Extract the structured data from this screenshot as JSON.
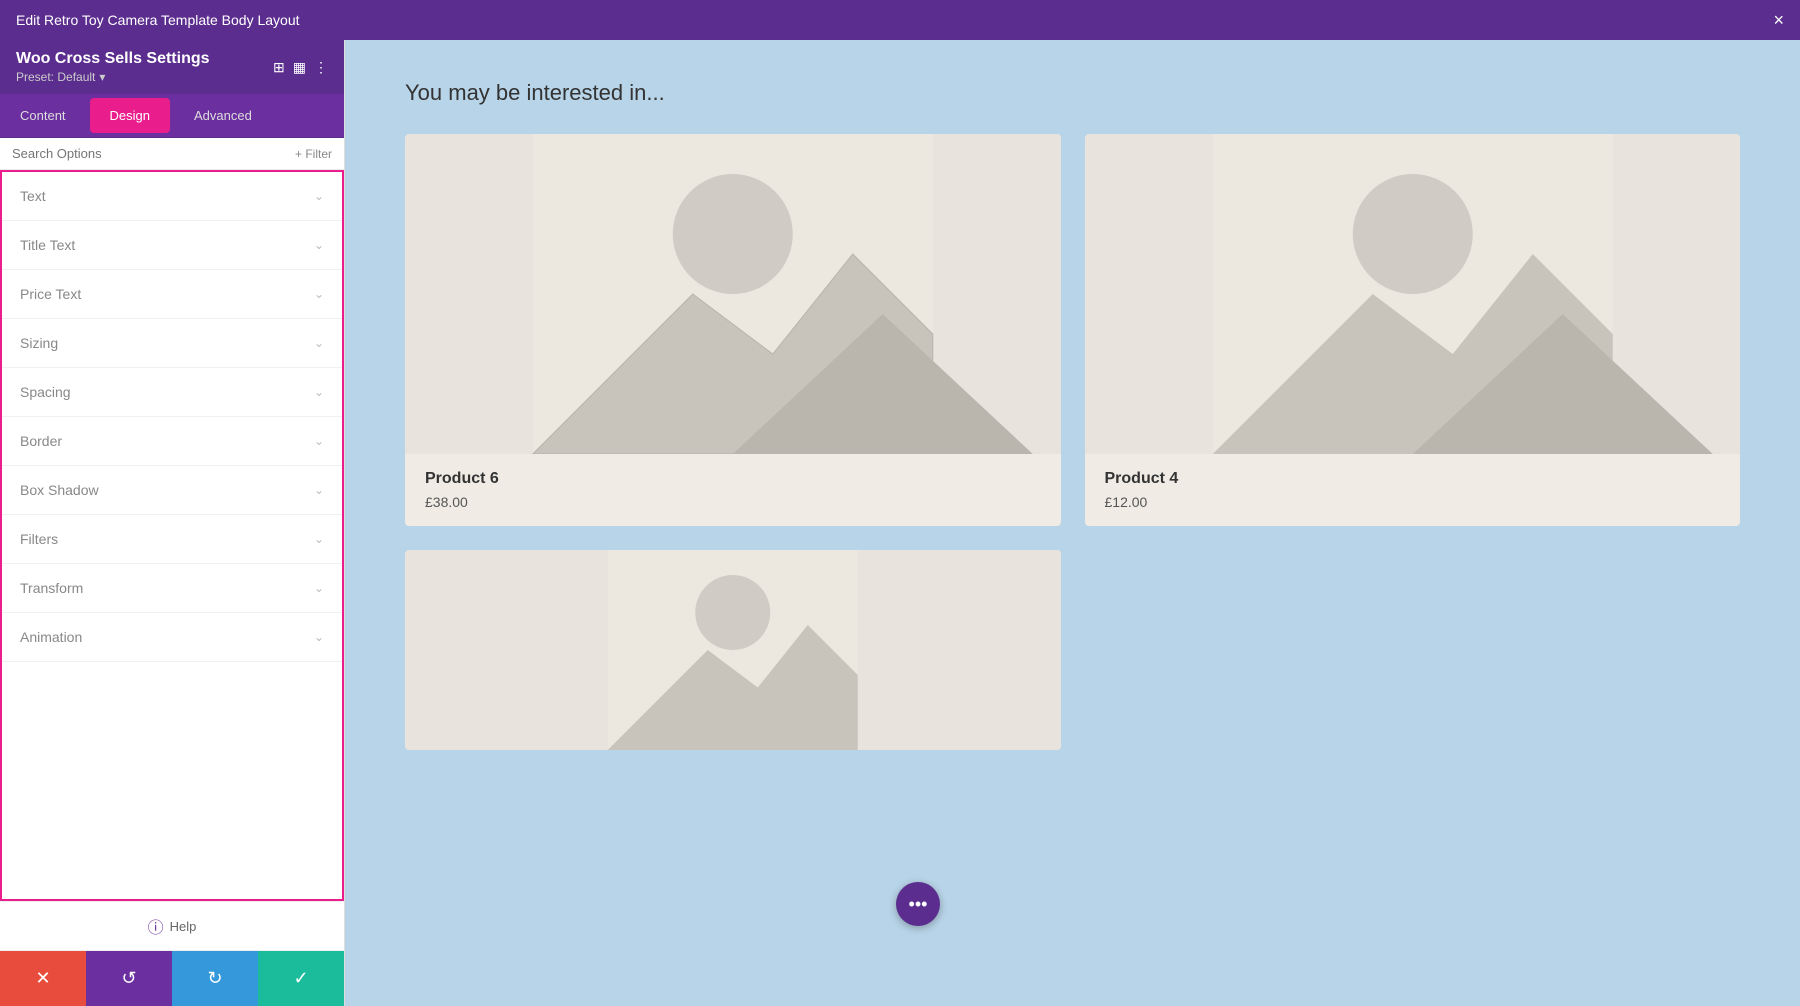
{
  "topBar": {
    "title": "Edit Retro Toy Camera Template Body Layout",
    "closeLabel": "×"
  },
  "moduleHeader": {
    "title": "Woo Cross Sells Settings",
    "preset": "Preset: Default",
    "presetChevron": "▾"
  },
  "moduleIcons": {
    "copy": "⊞",
    "grid": "▦",
    "more": "⋮"
  },
  "tabs": [
    {
      "id": "content",
      "label": "Content",
      "active": false
    },
    {
      "id": "design",
      "label": "Design",
      "active": true
    },
    {
      "id": "advanced",
      "label": "Advanced",
      "active": false
    }
  ],
  "searchBar": {
    "placeholder": "Search Options",
    "filterLabel": "+ Filter"
  },
  "optionItems": [
    {
      "id": "text",
      "label": "Text"
    },
    {
      "id": "title-text",
      "label": "Title Text"
    },
    {
      "id": "price-text",
      "label": "Price Text"
    },
    {
      "id": "sizing",
      "label": "Sizing"
    },
    {
      "id": "spacing",
      "label": "Spacing"
    },
    {
      "id": "border",
      "label": "Border"
    },
    {
      "id": "box-shadow",
      "label": "Box Shadow"
    },
    {
      "id": "filters",
      "label": "Filters"
    },
    {
      "id": "transform",
      "label": "Transform"
    },
    {
      "id": "animation",
      "label": "Animation"
    }
  ],
  "helpLabel": "Help",
  "toolbar": {
    "closeIcon": "✕",
    "undoIcon": "↺",
    "redoIcon": "↻",
    "saveIcon": "✓"
  },
  "mainContent": {
    "sectionTitle": "You may be interested in...",
    "products": [
      {
        "id": "product-6",
        "name": "Product 6",
        "price": "£38.00"
      },
      {
        "id": "product-4",
        "name": "Product 4",
        "price": "£12.00"
      },
      {
        "id": "product-3",
        "name": "",
        "price": ""
      }
    ]
  },
  "colors": {
    "purple": "#5b2d8e",
    "pink": "#e91e8c",
    "red": "#e74c3c",
    "blue": "#3498db",
    "teal": "#1abc9c",
    "lightBlue": "#b8d4e8"
  }
}
